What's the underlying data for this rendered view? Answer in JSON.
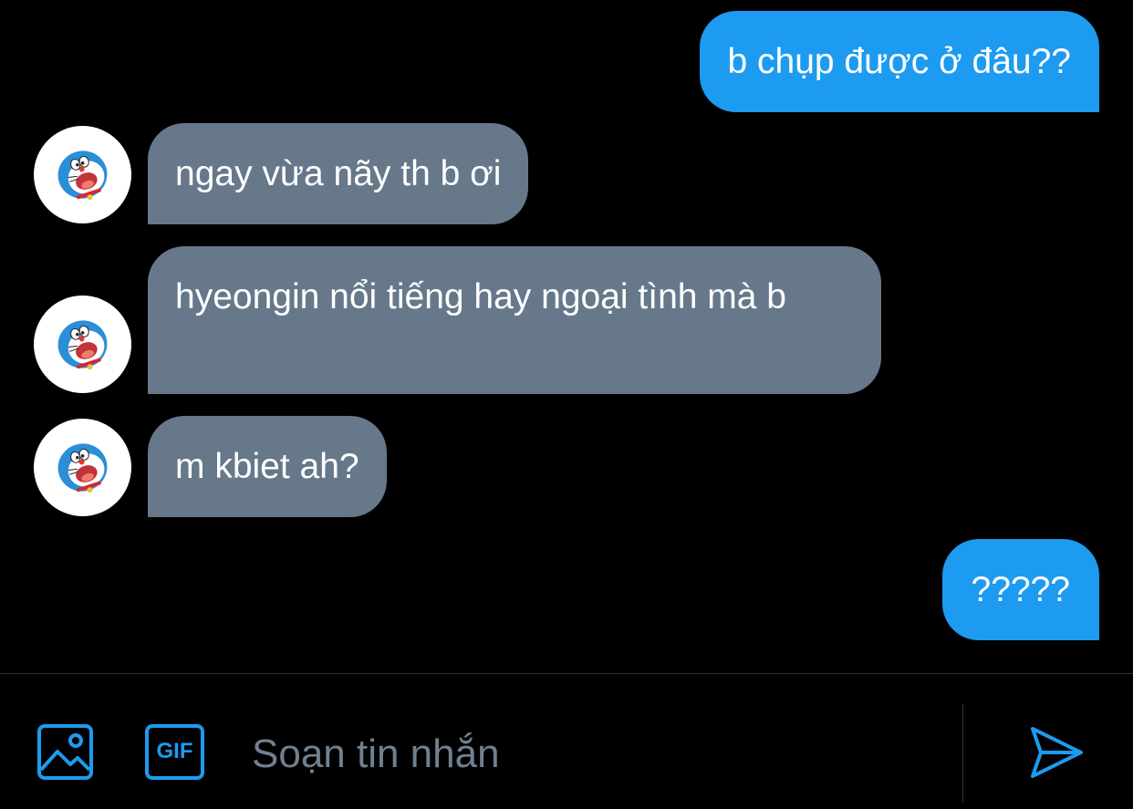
{
  "messages": [
    {
      "direction": "outgoing",
      "text": "b chụp được ở đâu??"
    },
    {
      "direction": "incoming",
      "text": "ngay vừa nãy th b ơi"
    },
    {
      "direction": "incoming",
      "text": "hyeongin nổi tiếng hay ngoại tình mà b"
    },
    {
      "direction": "incoming",
      "text": "m kbiet ah?"
    },
    {
      "direction": "outgoing",
      "text": "?????"
    }
  ],
  "composer": {
    "placeholder": "Soạn tin nhắn",
    "value": "",
    "media_icon": "image-icon",
    "gif_icon": "gif-icon",
    "gif_label": "GIF",
    "send_icon": "send-icon"
  },
  "colors": {
    "background": "#000000",
    "outgoing_bubble": "#1d9bf0",
    "incoming_bubble": "#66788a",
    "accent": "#1d9bf0",
    "placeholder": "#71808f",
    "divider": "#2f3336"
  }
}
